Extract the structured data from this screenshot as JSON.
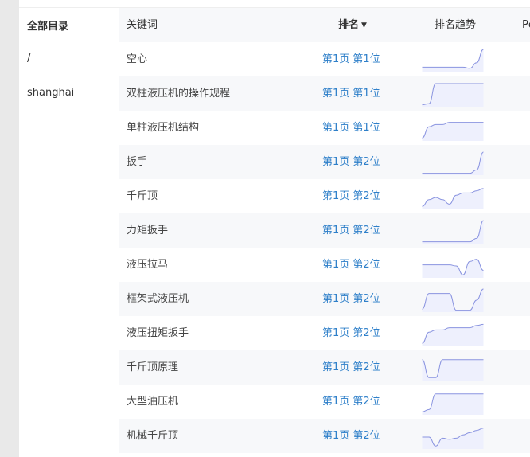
{
  "sidebar": {
    "title": "全部目录",
    "items": [
      {
        "label": "/"
      },
      {
        "label": "shanghai"
      }
    ]
  },
  "table": {
    "headers": {
      "keyword": "关键词",
      "rank": "排名",
      "trend": "排名趋势",
      "pc": "Pc"
    },
    "sort_icon": "caret-down-icon",
    "colors": {
      "rank_link": "#2e7fc9",
      "trend_line": "#8a94e0",
      "trend_fill": "#eef0fd"
    },
    "rows": [
      {
        "keyword": "空心",
        "rank": "第1页 第1位",
        "trend": [
          0.2,
          0.2,
          0.2,
          0.2,
          0.2,
          0.2,
          0.2,
          0.15,
          0.4,
          1.0
        ]
      },
      {
        "keyword": "双柱液压机的操作规程",
        "rank": "第1页 第1位",
        "trend": [
          0.05,
          0.1,
          1.0,
          1.0,
          1.0,
          1.0,
          1.0,
          1.0,
          1.0,
          1.0
        ]
      },
      {
        "keyword": "单柱液压机结构",
        "rank": "第1页 第1位",
        "trend": [
          0.1,
          0.6,
          0.7,
          0.7,
          0.8,
          0.8,
          0.8,
          0.8,
          0.8,
          0.8
        ]
      },
      {
        "keyword": "扳手",
        "rank": "第1页 第2位",
        "trend": [
          0.05,
          0.05,
          0.05,
          0.05,
          0.05,
          0.05,
          0.05,
          0.05,
          0.2,
          1.0
        ]
      },
      {
        "keyword": "千斤顶",
        "rank": "第1页 第2位",
        "trend": [
          0.1,
          0.4,
          0.5,
          0.4,
          0.2,
          0.6,
          0.7,
          0.7,
          0.8,
          0.9
        ]
      },
      {
        "keyword": "力矩扳手",
        "rank": "第1页 第2位",
        "trend": [
          0.05,
          0.05,
          0.05,
          0.05,
          0.05,
          0.05,
          0.05,
          0.05,
          0.2,
          1.0
        ]
      },
      {
        "keyword": "液压拉马",
        "rank": "第1页 第2位",
        "trend": [
          0.55,
          0.55,
          0.55,
          0.55,
          0.55,
          0.5,
          0.1,
          0.7,
          0.8,
          0.3
        ]
      },
      {
        "keyword": "框架式液压机",
        "rank": "第1页 第2位",
        "trend": [
          0.1,
          0.8,
          0.8,
          0.8,
          0.8,
          0.05,
          0.05,
          0.05,
          0.5,
          1.0
        ]
      },
      {
        "keyword": "液压扭矩扳手",
        "rank": "第1页 第2位",
        "trend": [
          0.1,
          0.6,
          0.7,
          0.7,
          0.8,
          0.8,
          0.8,
          0.8,
          0.9,
          0.95
        ]
      },
      {
        "keyword": "千斤顶原理",
        "rank": "第1页 第2位",
        "trend": [
          0.9,
          0.1,
          0.1,
          0.9,
          0.9,
          0.9,
          0.9,
          0.9,
          0.9,
          0.9
        ]
      },
      {
        "keyword": "大型油压机",
        "rank": "第1页 第2位",
        "trend": [
          0.1,
          0.2,
          0.9,
          0.9,
          0.9,
          0.9,
          0.9,
          0.9,
          0.9,
          0.9
        ]
      },
      {
        "keyword": "机械千斤顶",
        "rank": "第1页 第2位",
        "trend": [
          0.5,
          0.5,
          0.1,
          0.45,
          0.4,
          0.45,
          0.6,
          0.7,
          0.8,
          0.9
        ]
      }
    ]
  }
}
